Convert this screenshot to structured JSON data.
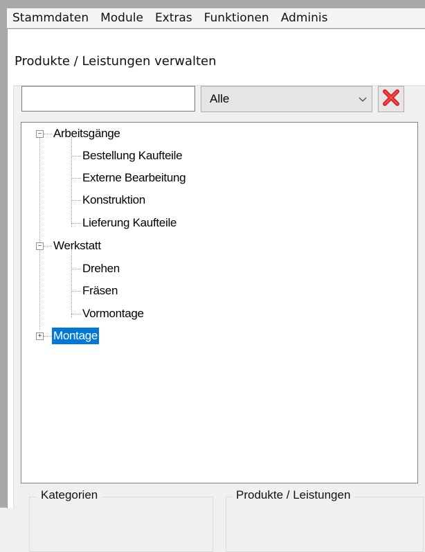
{
  "menu": [
    "Stammdaten",
    "Module",
    "Extras",
    "Funktionen",
    "Adminis"
  ],
  "window": {
    "title": "Produkte / Leistungen verwalten"
  },
  "search": {
    "value": "",
    "placeholder": ""
  },
  "filter": {
    "selected": "Alle"
  },
  "clear_icon": "red-x-icon",
  "tree": {
    "arbeitsgaenge": {
      "label": "Arbeitsgänge",
      "expanded": true,
      "children": [
        "Bestellung Kaufteile",
        "Externe Bearbeitung",
        "Konstruktion",
        "Lieferung Kaufteile"
      ]
    },
    "werkstatt": {
      "label": "Werkstatt",
      "expanded": true,
      "children": [
        "Drehen",
        "Fräsen",
        "Vormontage"
      ]
    },
    "montage": {
      "label": "Montage",
      "expanded": false,
      "selected": true
    }
  },
  "groups": {
    "kategorien": "Kategorien",
    "produkte": "Produkte / Leistungen"
  },
  "colors": {
    "selection": "#0078d7",
    "clear_icon": "#d9232a"
  }
}
